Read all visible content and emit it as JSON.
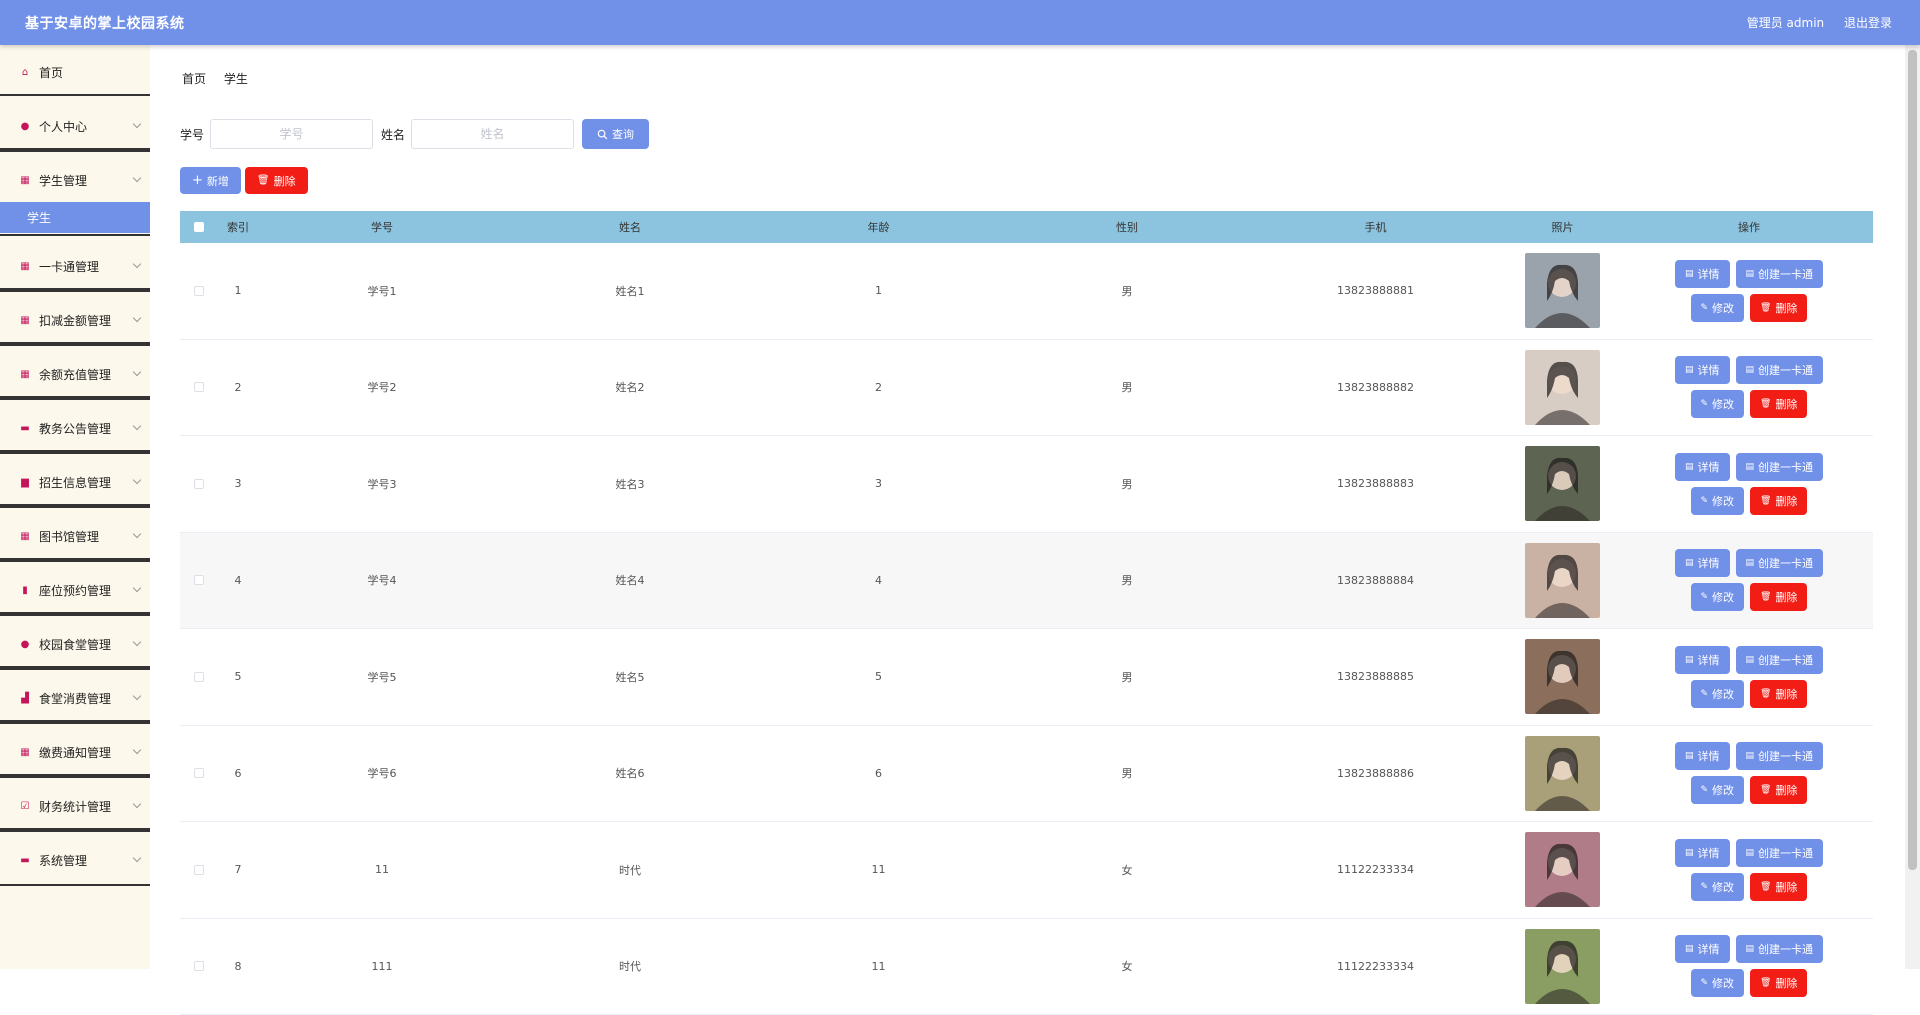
{
  "header": {
    "title": "基于安卓的掌上校园系统",
    "user": "管理员 admin",
    "logout": "退出登录"
  },
  "sidebar": {
    "items": [
      {
        "label": "首页",
        "icon": "home-icon",
        "glyph": "⌂"
      },
      {
        "label": "个人中心",
        "icon": "user-icon",
        "glyph": "●"
      },
      {
        "label": "学生管理",
        "icon": "grid-icon",
        "glyph": "▦",
        "sub": "学生"
      },
      {
        "label": "一卡通管理",
        "icon": "grid-icon",
        "glyph": "▦"
      },
      {
        "label": "扣减金额管理",
        "icon": "grid-icon",
        "glyph": "▦"
      },
      {
        "label": "余额充值管理",
        "icon": "grid-icon",
        "glyph": "▦"
      },
      {
        "label": "教务公告管理",
        "icon": "message-icon",
        "glyph": "▬"
      },
      {
        "label": "招生信息管理",
        "icon": "briefcase-icon",
        "glyph": "▆"
      },
      {
        "label": "图书馆管理",
        "icon": "grid-icon",
        "glyph": "▦"
      },
      {
        "label": "座位预约管理",
        "icon": "clipboard-icon",
        "glyph": "▮"
      },
      {
        "label": "校园食堂管理",
        "icon": "user-icon",
        "glyph": "●"
      },
      {
        "label": "食堂消费管理",
        "icon": "chart-icon",
        "glyph": "▟"
      },
      {
        "label": "缴费通知管理",
        "icon": "grid-icon",
        "glyph": "▦"
      },
      {
        "label": "财务统计管理",
        "icon": "check-icon",
        "glyph": "☑"
      },
      {
        "label": "系统管理",
        "icon": "message-icon",
        "glyph": "▬"
      }
    ]
  },
  "breadcrumb": [
    "首页",
    "学生"
  ],
  "search": {
    "sid_label": "学号",
    "sid_placeholder": "学号",
    "name_label": "姓名",
    "name_placeholder": "姓名",
    "query": "查询"
  },
  "toolbar": {
    "add": "新增",
    "delete": "删除"
  },
  "table": {
    "headers": [
      "索引",
      "学号",
      "姓名",
      "年龄",
      "性别",
      "手机",
      "照片",
      "操作"
    ],
    "rows": [
      {
        "idx": "1",
        "sid": "学号1",
        "name": "姓名1",
        "age": "1",
        "sex": "男",
        "tel": "13823888881",
        "photo": "#9aa3ab"
      },
      {
        "idx": "2",
        "sid": "学号2",
        "name": "姓名2",
        "age": "2",
        "sex": "男",
        "tel": "13823888882",
        "photo": "#d8cdc4"
      },
      {
        "idx": "3",
        "sid": "学号3",
        "name": "姓名3",
        "age": "3",
        "sex": "男",
        "tel": "13823888883",
        "photo": "#5d6451"
      },
      {
        "idx": "4",
        "sid": "学号4",
        "name": "姓名4",
        "age": "4",
        "sex": "男",
        "tel": "13823888884",
        "photo": "#c9b2a4"
      },
      {
        "idx": "5",
        "sid": "学号5",
        "name": "姓名5",
        "age": "5",
        "sex": "男",
        "tel": "13823888885",
        "photo": "#8b6f5c"
      },
      {
        "idx": "6",
        "sid": "学号6",
        "name": "姓名6",
        "age": "6",
        "sex": "男",
        "tel": "13823888886",
        "photo": "#a9a07a"
      },
      {
        "idx": "7",
        "sid": "11",
        "name": "时代",
        "age": "11",
        "sex": "女",
        "tel": "11122233334",
        "photo": "#b07c88"
      },
      {
        "idx": "8",
        "sid": "111",
        "name": "时代",
        "age": "11",
        "sex": "女",
        "tel": "11122233334",
        "photo": "#8a9d62"
      }
    ],
    "ops": {
      "detail": "详情",
      "card": "创建一卡通",
      "edit": "修改",
      "delete": "删除"
    }
  }
}
